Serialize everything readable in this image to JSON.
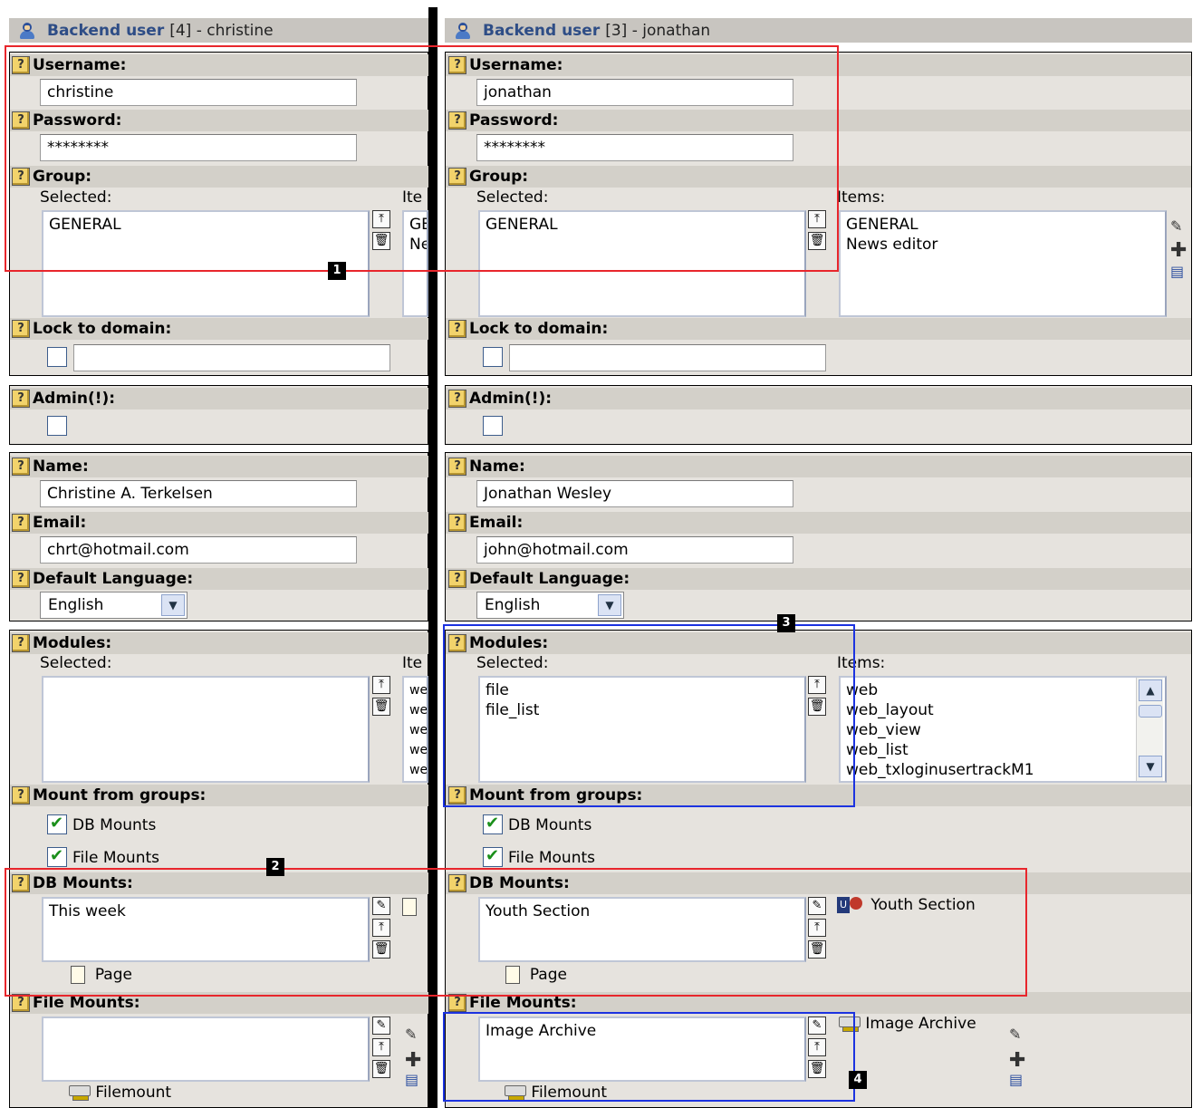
{
  "left": {
    "header": {
      "title": "Backend user",
      "id": "[4]",
      "name": "- christine"
    },
    "username_label": "Username:",
    "username": "christine",
    "password_label": "Password:",
    "password": "********",
    "group_label": "Group:",
    "group_selected_label": "Selected:",
    "group_items_label": "Ite",
    "group_selected": [
      "GENERAL"
    ],
    "group_items": [
      "GE",
      "Ne"
    ],
    "lock_label": "Lock to domain:",
    "admin_label": "Admin(!):",
    "name_label": "Name:",
    "name": "Christine A. Terkelsen",
    "email_label": "Email:",
    "email": "chrt@hotmail.com",
    "lang_label": "Default Language:",
    "lang": "English",
    "modules_label": "Modules:",
    "modules_selected_label": "Selected:",
    "modules_items_label": "Ite",
    "modules_items": [
      "we",
      "we",
      "we",
      "we",
      "we"
    ],
    "mount_groups_label": "Mount from groups:",
    "mount_db": "DB Mounts",
    "mount_file": "File Mounts",
    "db_mounts_label": "DB Mounts:",
    "db_mounts": [
      "This week"
    ],
    "db_page_label": "Page",
    "file_mounts_label": "File Mounts:",
    "file_mounts": [],
    "filemount_label": "Filemount"
  },
  "right": {
    "header": {
      "title": "Backend user",
      "id": "[3]",
      "name": "- jonathan"
    },
    "username_label": "Username:",
    "username": "jonathan",
    "password_label": "Password:",
    "password": "********",
    "group_label": "Group:",
    "group_selected_label": "Selected:",
    "group_items_label": "Items:",
    "group_selected": [
      "GENERAL"
    ],
    "group_items": [
      "GENERAL",
      "News editor"
    ],
    "lock_label": "Lock to domain:",
    "admin_label": "Admin(!):",
    "name_label": "Name:",
    "name": "Jonathan Wesley",
    "email_label": "Email:",
    "email": "john@hotmail.com",
    "lang_label": "Default Language:",
    "lang": "English",
    "modules_label": "Modules:",
    "modules_selected_label": "Selected:",
    "modules_items_label": "Items:",
    "modules_selected": [
      "file",
      "file_list"
    ],
    "modules_items": [
      "web",
      "web_layout",
      "web_view",
      "web_list",
      "web_txloginusertrackM1"
    ],
    "mount_groups_label": "Mount from groups:",
    "mount_db": "DB Mounts",
    "mount_file": "File Mounts",
    "db_mounts_label": "DB Mounts:",
    "db_mounts": [
      "Youth Section"
    ],
    "db_mount_preview": "Youth Section",
    "db_page_label": "Page",
    "file_mounts_label": "File Mounts:",
    "file_mounts": [
      "Image Archive"
    ],
    "file_mount_preview": "Image Archive",
    "filemount_label": "Filemount"
  },
  "markers": [
    "1",
    "2",
    "3",
    "4"
  ],
  "colors": {
    "red_box": "#e8262c",
    "blue_box": "#1c33e0",
    "header_bg": "#c8c5c0",
    "panel_bg": "#e6e3de"
  }
}
